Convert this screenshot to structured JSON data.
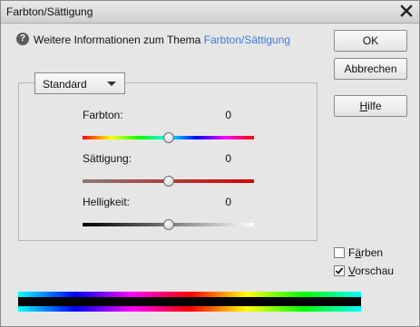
{
  "window": {
    "title": "Farbton/Sättigung"
  },
  "info": {
    "text": "Weitere Informationen zum Thema",
    "link": "Farbton/Sättigung"
  },
  "buttons": {
    "ok": "OK",
    "cancel": "Abbrechen",
    "help": "Hilfe"
  },
  "preset": {
    "selected": "Standard"
  },
  "sliders": [
    {
      "label": "Farbton:",
      "value": "0",
      "position": 0.5
    },
    {
      "label": "Sättigung:",
      "value": "0",
      "position": 0.5
    },
    {
      "label": "Helligkeit:",
      "value": "0",
      "position": 0.5
    }
  ],
  "options": {
    "colorize": {
      "label": "Färben",
      "checked": false
    },
    "preview": {
      "label": "Vorschau",
      "checked": true
    }
  },
  "colors": {
    "link": "#3b7bd8",
    "dialog_bg": "#e6e6e6"
  },
  "icons": {
    "info": "question-info-icon",
    "close": "close-icon",
    "dropdown": "chevron-down-icon"
  }
}
